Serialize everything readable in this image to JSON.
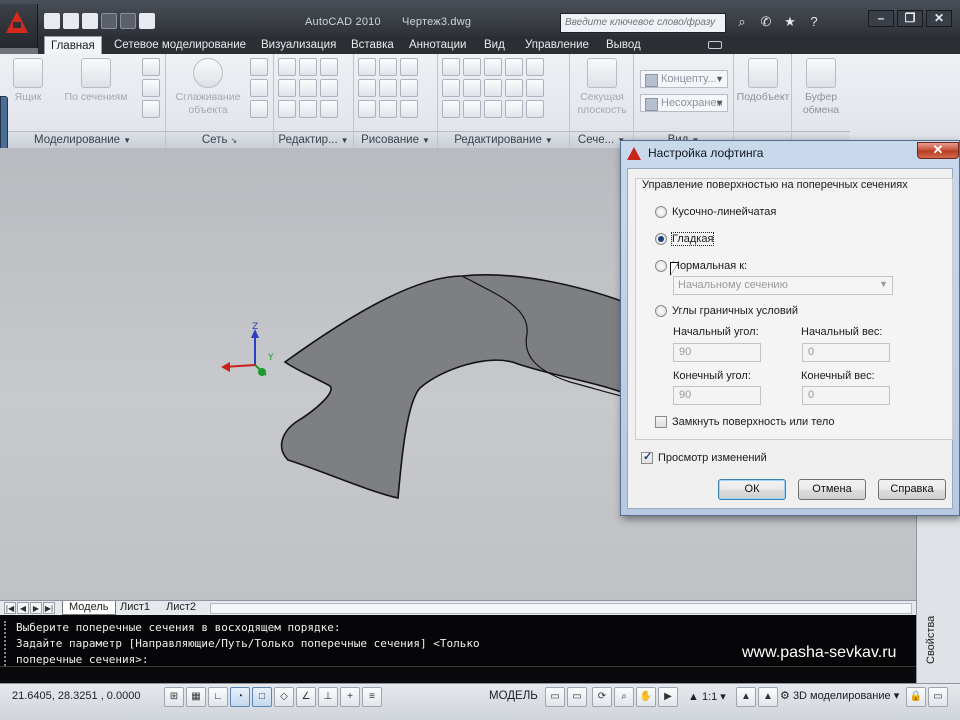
{
  "title_bar": {
    "app_name": "AutoCAD 2010",
    "document_name": "Чертеж3.dwg",
    "search_placeholder": "Введите ключевое слово/фразу"
  },
  "ribbon": {
    "tabs": [
      "Главная",
      "Сетевое моделирование",
      "Визуализация",
      "Вставка",
      "Аннотации",
      "Вид",
      "Управление",
      "Вывод"
    ],
    "active_tab": "Главная",
    "panels": {
      "modeling": {
        "caption": "Моделирование",
        "box_label": "Ящик",
        "section_label": "По сечениям"
      },
      "mesh": {
        "caption": "Сеть",
        "smooth_label_1": "Сглаживание",
        "smooth_label_2": "объекта"
      },
      "edit1": {
        "caption": "Редактир..."
      },
      "draw": {
        "caption": "Рисование"
      },
      "edit2": {
        "caption": "Редактирование"
      },
      "section": {
        "caption": "Сече...",
        "plane_label_1": "Секущая",
        "plane_label_2": "плоскость"
      },
      "view": {
        "caption": "Вид",
        "visual_style": "Концепту...",
        "saved_view": "Несохранен"
      },
      "match": {
        "label_1": "Подобъект"
      },
      "clipboard": {
        "label_1": "Буфер",
        "label_2": "обмена"
      }
    }
  },
  "viewport": {
    "ucs_z": "Z",
    "ucs_y": "Y"
  },
  "layout_tabs": [
    "Модель",
    "Лист1",
    "Лист2"
  ],
  "active_layout": "Модель",
  "command_line": {
    "lines": [
      "Выберите поперечные сечения в восходящем порядке:",
      "Задайте параметр [Направляющие/Путь/Только поперечные сечения] <Только",
      "поперечные сечения>:"
    ]
  },
  "watermark": "www.pasha-sevkav.ru",
  "properties_palette": {
    "label": "Свойства"
  },
  "status_bar": {
    "coordinates": "21.6405, 28.3251 , 0.0000",
    "model_label": "МОДЕЛЬ",
    "annotation_scale": "1:1",
    "workspace": "3D моделирование"
  },
  "dialog": {
    "title": "Настройка лофтинга",
    "group_title": "Управление поверхностью на поперечных сечениях",
    "options": {
      "ruled": "Кусочно-линейчатая",
      "smooth": "Гладкая",
      "normal_to": "Нормальная к:",
      "draft_angles": "Углы граничных условий"
    },
    "selected_option": "Гладкая",
    "normal_to_value": "Начальному сечению",
    "start_angle_label": "Начальный угол:",
    "start_angle_value": "90",
    "start_magnitude_label": "Начальный вес:",
    "start_magnitude_value": "0",
    "end_angle_label": "Конечный угол:",
    "end_angle_value": "90",
    "end_magnitude_label": "Конечный вес:",
    "end_magnitude_value": "0",
    "close_surface": "Замкнуть поверхность или тело",
    "close_surface_checked": false,
    "preview": "Просмотр изменений",
    "preview_checked": true,
    "buttons": {
      "ok": "ОК",
      "cancel": "Отмена",
      "help": "Справка"
    },
    "close_glyph": "✕"
  }
}
